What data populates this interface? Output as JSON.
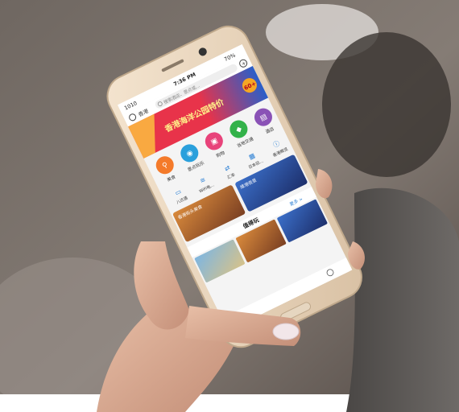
{
  "status_bar": {
    "carrier": "1010",
    "time": "7:36 PM",
    "battery": "70%"
  },
  "header": {
    "location": "香港",
    "search_placeholder": "搜索酒店、景点或..."
  },
  "banner": {
    "headline": "香港海洋公园特价",
    "tag": "60+"
  },
  "categories": [
    {
      "label": "美食",
      "color": "#f47a2a",
      "icon": "fork-knife-icon"
    },
    {
      "label": "景点玩乐",
      "color": "#2aa0dc",
      "icon": "camera-icon"
    },
    {
      "label": "购物",
      "color": "#e8437a",
      "icon": "shopping-bag-icon"
    },
    {
      "label": "当地交通",
      "color": "#33b24a",
      "icon": "car-icon"
    },
    {
      "label": "酒店",
      "color": "#8a52b6",
      "icon": "hotel-icon"
    }
  ],
  "services": [
    {
      "label": "八达通",
      "icon": "card-icon"
    },
    {
      "label": "WiFi电...",
      "icon": "wifi-icon"
    },
    {
      "label": "汇率",
      "icon": "exchange-icon"
    },
    {
      "label": "日本旧...",
      "icon": "ticket-icon"
    },
    {
      "label": "香港概览",
      "icon": "info-icon"
    }
  ],
  "promo_cards": [
    {
      "title": "香港街头美食"
    },
    {
      "title": "维港夜景"
    }
  ],
  "featured": {
    "heading": "值得玩",
    "more_link": "更多 >"
  },
  "colors": {
    "banner_red": "#e8334a",
    "banner_blue": "#2a5fc9",
    "accent": "#f5a623"
  }
}
